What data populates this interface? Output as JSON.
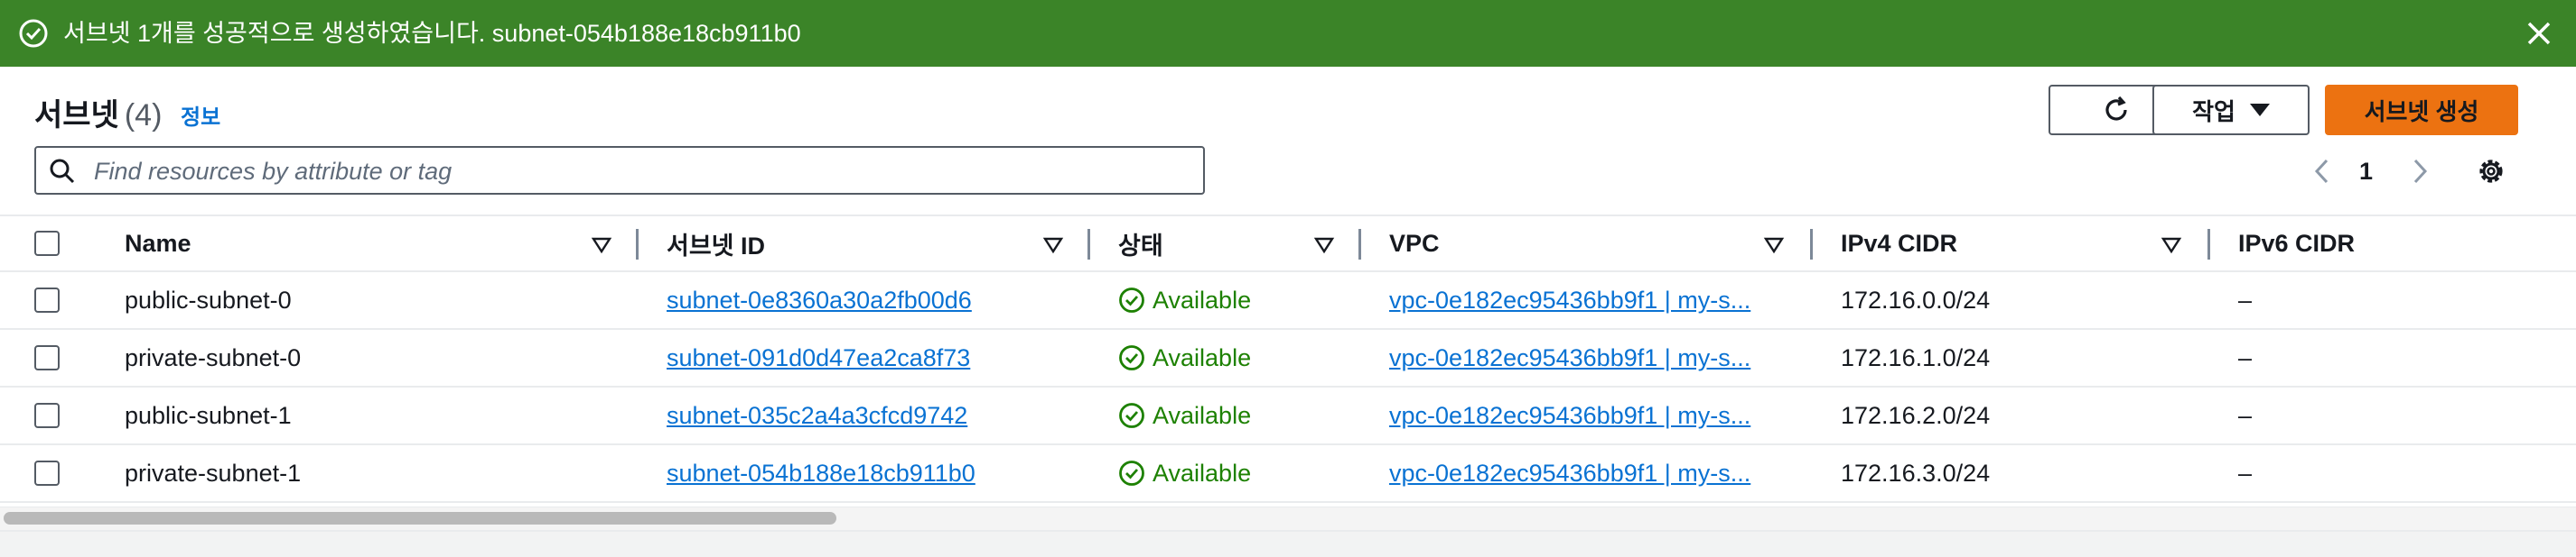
{
  "flash": {
    "message": "서브넷 1개를 성공적으로 생성하였습니다. subnet-054b188e18cb911b0",
    "color": "#3b8428"
  },
  "header": {
    "title": "서브넷",
    "count": "(4)",
    "info_link": "정보"
  },
  "toolbar": {
    "actions_label": "작업",
    "create_label": "서브넷 생성",
    "accent_color": "#ec7211"
  },
  "search": {
    "placeholder": "Find resources by attribute or tag",
    "value": ""
  },
  "pagination": {
    "current_page": "1"
  },
  "table": {
    "columns": [
      "Name",
      "서브넷 ID",
      "상태",
      "VPC",
      "IPv4 CIDR",
      "IPv6 CIDR"
    ],
    "rows": [
      {
        "name": "public-subnet-0",
        "subnet_id": "subnet-0e8360a30a2fb00d6",
        "status": "Available",
        "vpc": "vpc-0e182ec95436bb9f1 | my-s...",
        "ipv4": "172.16.0.0/24",
        "ipv6": "–"
      },
      {
        "name": "private-subnet-0",
        "subnet_id": "subnet-091d0d47ea2ca8f73",
        "status": "Available",
        "vpc": "vpc-0e182ec95436bb9f1 | my-s...",
        "ipv4": "172.16.1.0/24",
        "ipv6": "–"
      },
      {
        "name": "public-subnet-1",
        "subnet_id": "subnet-035c2a4a3cfcd9742",
        "status": "Available",
        "vpc": "vpc-0e182ec95436bb9f1 | my-s...",
        "ipv4": "172.16.2.0/24",
        "ipv6": "–"
      },
      {
        "name": "private-subnet-1",
        "subnet_id": "subnet-054b188e18cb911b0",
        "status": "Available",
        "vpc": "vpc-0e182ec95436bb9f1 | my-s...",
        "ipv4": "172.16.3.0/24",
        "ipv6": "–"
      }
    ]
  },
  "icons": [
    "check-circle-icon",
    "close-icon",
    "refresh-icon",
    "caret-down-icon",
    "search-icon",
    "chevron-left-icon",
    "chevron-right-icon",
    "gear-icon",
    "sort-icon"
  ]
}
